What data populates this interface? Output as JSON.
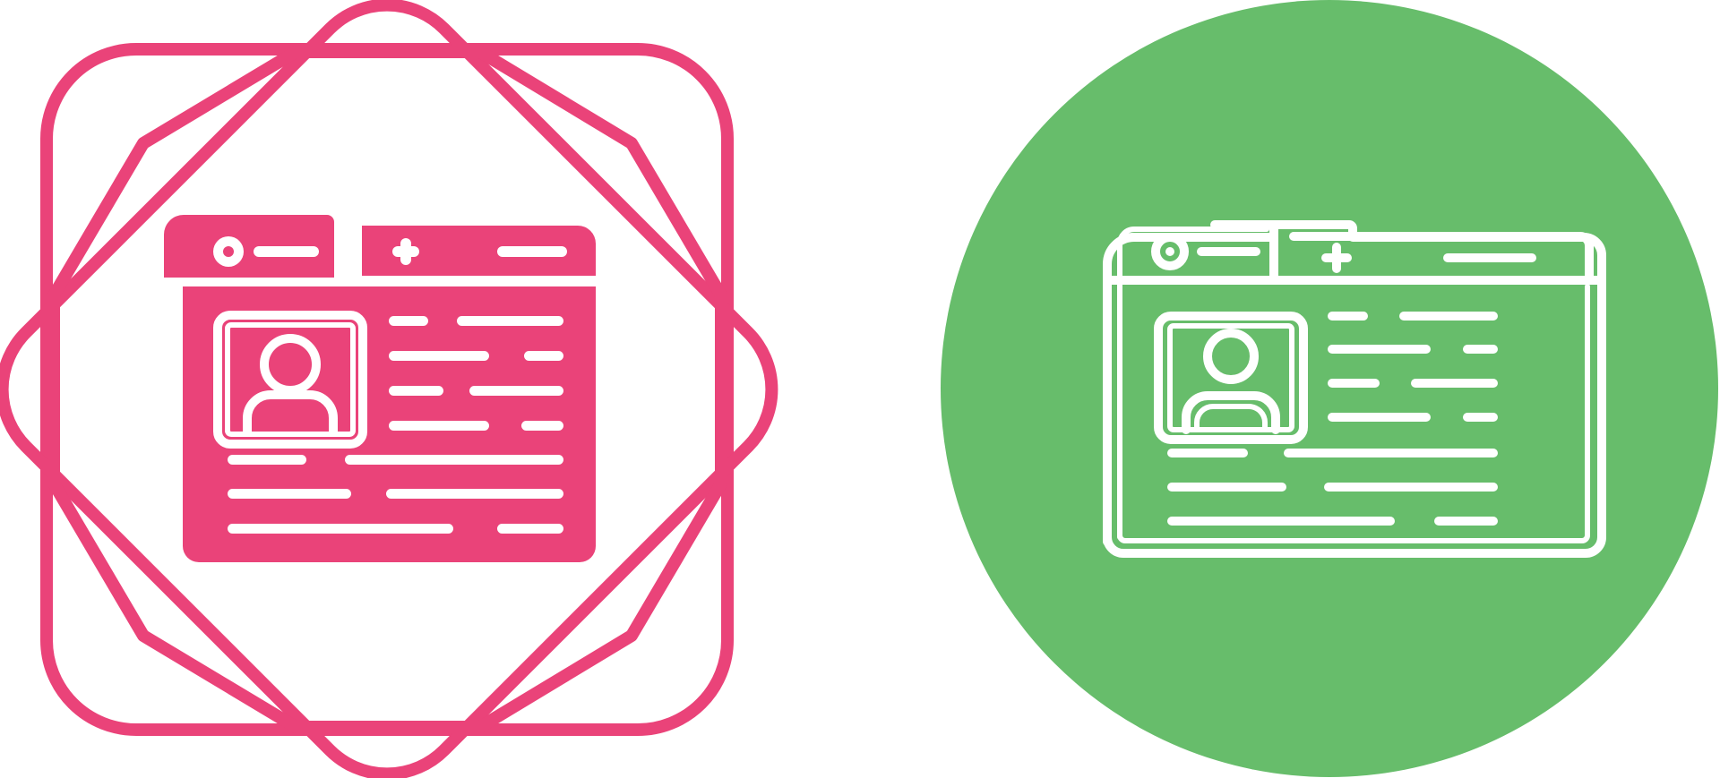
{
  "icons": [
    {
      "name": "online-medical-profile-glyph",
      "style": "glyph",
      "badge": "octagonal-seal-badge",
      "color": "#ea4379"
    },
    {
      "name": "online-medical-profile-line",
      "style": "line",
      "badge": "circle-badge",
      "color": "#67bd6b",
      "stroke_color": "#ffffff"
    }
  ]
}
